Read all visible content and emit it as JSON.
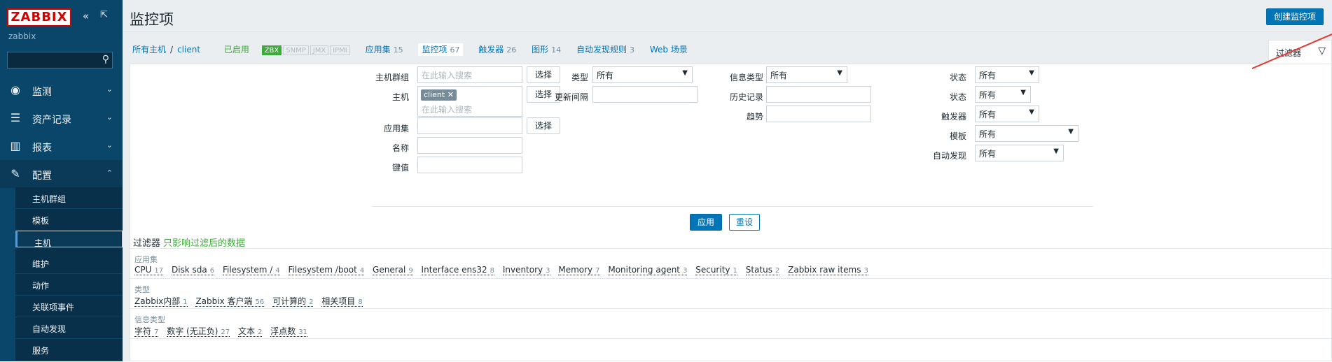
{
  "sidebar": {
    "logo": "ZABBIX",
    "server_name": "zabbix",
    "menu": [
      {
        "label": "监测",
        "icon": "eye-icon"
      },
      {
        "label": "资产记录",
        "icon": "list-icon"
      },
      {
        "label": "报表",
        "icon": "bar-chart-icon"
      },
      {
        "label": "配置",
        "icon": "wrench-icon"
      }
    ],
    "submenu": [
      "主机群组",
      "模板",
      "主机",
      "维护",
      "动作",
      "关联项事件",
      "自动发现",
      "服务"
    ]
  },
  "header": {
    "title": "监控项",
    "create_button": "创建监控项"
  },
  "nav": {
    "all_hosts": "所有主机",
    "sep": "/",
    "host": "client",
    "enabled": "已启用",
    "tags": [
      "ZBX",
      "SNMP",
      "JMX",
      "IPMI"
    ],
    "links": [
      {
        "label": "应用集",
        "count": "15"
      },
      {
        "label": "监控项",
        "count": "67"
      },
      {
        "label": "触发器",
        "count": "26"
      },
      {
        "label": "图形",
        "count": "14"
      },
      {
        "label": "自动发现规则",
        "count": "3"
      },
      {
        "label": "Web 场景",
        "count": ""
      }
    ]
  },
  "filter_tab": {
    "label": "过滤器"
  },
  "filter": {
    "host_group_label": "主机群组",
    "host_group_placeholder": "在此输入搜索",
    "select_button": "选择",
    "host_label": "主机",
    "host_chip": "client",
    "host_placeholder": "在此输入搜索",
    "app_label": "应用集",
    "name_label": "名称",
    "key_label": "键值",
    "type_label": "类型",
    "type_value": "所有",
    "interval_label": "更新间隔",
    "info_type_label": "信息类型",
    "info_type_value": "所有",
    "history_label": "历史记录",
    "trend_label": "趋势",
    "state_label": "状态",
    "state_value": "所有",
    "status_label": "状态",
    "status_value": "所有",
    "triggers_label": "触发器",
    "triggers_value": "所有",
    "template_label": "模板",
    "template_value": "所有",
    "discovery_label": "自动发现",
    "discovery_value": "所有",
    "apply": "应用",
    "reset": "重设"
  },
  "subfilter": {
    "title": "过滤器",
    "hint": "只影响过滤后的数据",
    "sections": [
      {
        "heading": "应用集",
        "items": [
          {
            "label": "CPU",
            "count": "17"
          },
          {
            "label": "Disk sda",
            "count": "6"
          },
          {
            "label": "Filesystem /",
            "count": "4"
          },
          {
            "label": "Filesystem /boot",
            "count": "4"
          },
          {
            "label": "General",
            "count": "9"
          },
          {
            "label": "Interface ens32",
            "count": "8"
          },
          {
            "label": "Inventory",
            "count": "3"
          },
          {
            "label": "Memory",
            "count": "7"
          },
          {
            "label": "Monitoring agent",
            "count": "3"
          },
          {
            "label": "Security",
            "count": "1"
          },
          {
            "label": "Status",
            "count": "2"
          },
          {
            "label": "Zabbix raw items",
            "count": "3"
          }
        ]
      },
      {
        "heading": "类型",
        "items": [
          {
            "label": "Zabbix内部",
            "count": "1"
          },
          {
            "label": "Zabbix 客户端",
            "count": "56"
          },
          {
            "label": "可计算的",
            "count": "2"
          },
          {
            "label": "相关项目",
            "count": "8"
          }
        ]
      },
      {
        "heading": "信息类型",
        "items": [
          {
            "label": "字符",
            "count": "7"
          },
          {
            "label": "数字 (无正负)",
            "count": "27"
          },
          {
            "label": "文本",
            "count": "2"
          },
          {
            "label": "浮点数",
            "count": "31"
          }
        ]
      }
    ]
  },
  "colors": {
    "accent": "#0275b8",
    "sidebar": "#0a466a",
    "enabled": "#3cab39",
    "annotation_arrow": "#e53935"
  }
}
